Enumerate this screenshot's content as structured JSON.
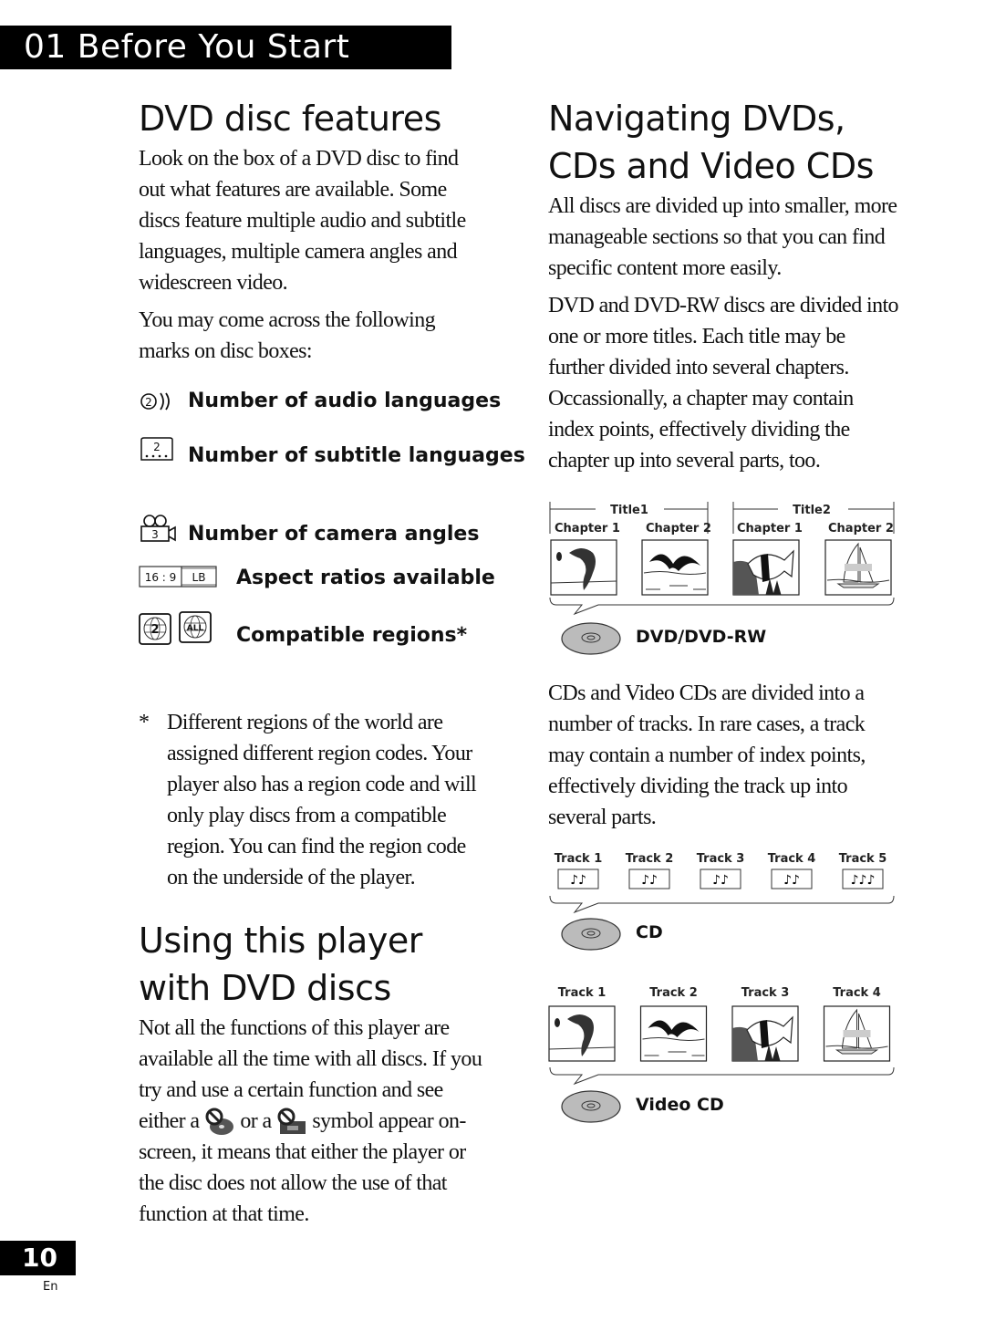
{
  "chapter": {
    "label": "01 Before You Start"
  },
  "left": {
    "dvd_features": {
      "heading": "DVD disc features",
      "para1": "Look on the box of a DVD disc to find out what features are available. Some discs feature multiple audio and subtitle languages, multiple camera angles and widescreen video.",
      "para2": "You may come across the following marks on disc boxes:",
      "marks": [
        {
          "icon": "audio-languages-icon",
          "icon_text": "2",
          "label": "Number of audio languages"
        },
        {
          "icon": "subtitle-languages-icon",
          "icon_text": "2",
          "label": "Number of subtitle languages"
        },
        {
          "icon": "camera-angles-icon",
          "icon_text": "3",
          "label": "Number of camera angles"
        },
        {
          "icon": "aspect-ratio-icon",
          "icon_text_a": "16 : 9",
          "icon_text_b": "LB",
          "label": "Aspect ratios available"
        },
        {
          "icon": "region-globe-icon",
          "icon_text_a": "2",
          "icon_text_b": "ALL",
          "label": "Compatible regions*"
        }
      ],
      "footnote_marker": "*",
      "footnote": "Different regions of the world are assigned different region codes. Your player also has a region code and will only play discs from a compatible region. You can find the region code on the underside of the player."
    },
    "using_player": {
      "heading": "Using this player with DVD discs",
      "text_before": "Not all the functions of this player are available all the time with all discs. If you try and use a certain function and see either a",
      "text_middle": "or a",
      "text_after": "symbol appear on-screen, it means that either the player or the disc does not allow the use of that function at that time.",
      "icons": [
        "prohibited-disc-icon",
        "prohibited-player-icon"
      ]
    }
  },
  "right": {
    "navigating": {
      "heading": "Navigating DVDs, CDs and Video CDs",
      "para1": "All discs are divided up into smaller, more manageable sections so that you can find specific content more easily.",
      "para2": "DVD and DVD-RW discs are divided into one or more titles. Each title may be further divided into several chapters. Occassionally, a chapter may contain index points, effectively dividing the chapter up into several parts, too.",
      "para3": "CDs and Video CDs are divided into a number of tracks. In rare cases, a track may contain a number of index points, effectively dividing the track up into several parts."
    },
    "dvd_diagram": {
      "titles": [
        {
          "label": "Title1",
          "chapters": [
            {
              "label": "Chapter 1",
              "image": "dolphin"
            },
            {
              "label": "Chapter 2",
              "image": "bird"
            }
          ]
        },
        {
          "label": "Title2",
          "chapters": [
            {
              "label": "Chapter 1",
              "image": "fish"
            },
            {
              "label": "Chapter 2",
              "image": "sailboat"
            }
          ]
        }
      ],
      "disc_label": "DVD/DVD-RW"
    },
    "cd_diagram": {
      "tracks": [
        {
          "label": "Track 1",
          "notes": "♪♪"
        },
        {
          "label": "Track 2",
          "notes": "♪♪"
        },
        {
          "label": "Track 3",
          "notes": "♪♪"
        },
        {
          "label": "Track 4",
          "notes": "♪♪"
        },
        {
          "label": "Track 5",
          "notes": "♪♪♪"
        }
      ],
      "disc_label": "CD"
    },
    "vcd_diagram": {
      "tracks": [
        {
          "label": "Track 1",
          "image": "dolphin"
        },
        {
          "label": "Track 2",
          "image": "bird"
        },
        {
          "label": "Track 3",
          "image": "fish"
        },
        {
          "label": "Track 4",
          "image": "sailboat"
        }
      ],
      "disc_label": "Video CD"
    }
  },
  "footer": {
    "page_number": "10",
    "language": "En"
  }
}
